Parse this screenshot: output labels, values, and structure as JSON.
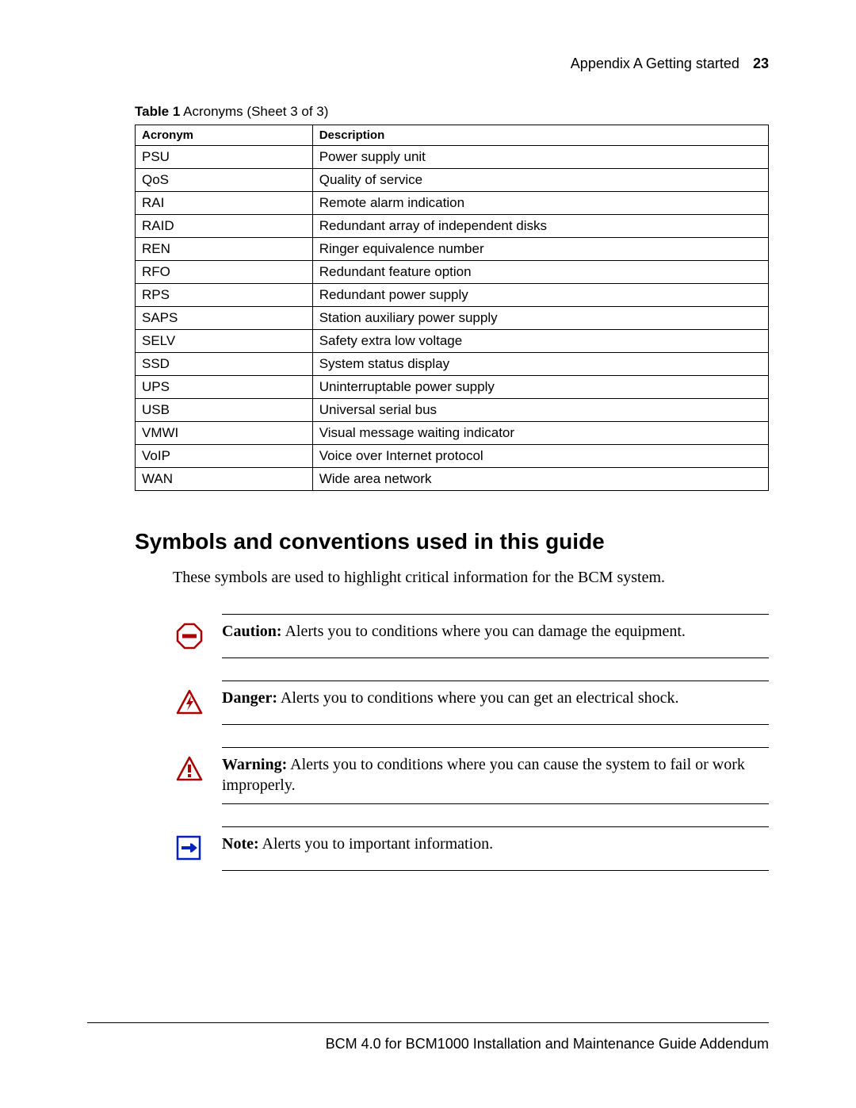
{
  "header": {
    "section": "Appendix A  Getting started",
    "page_number": "23"
  },
  "table_caption": {
    "prefix": "Table 1",
    "rest": "   Acronyms (Sheet 3 of 3)"
  },
  "table": {
    "head": {
      "col1": "Acronym",
      "col2": "Description"
    },
    "rows": [
      {
        "a": "PSU",
        "d": "Power supply unit"
      },
      {
        "a": "QoS",
        "d": "Quality of service"
      },
      {
        "a": "RAI",
        "d": "Remote alarm indication"
      },
      {
        "a": "RAID",
        "d": "Redundant array of independent disks"
      },
      {
        "a": "REN",
        "d": "Ringer equivalence number"
      },
      {
        "a": "RFO",
        "d": "Redundant feature option"
      },
      {
        "a": "RPS",
        "d": "Redundant power supply"
      },
      {
        "a": "SAPS",
        "d": "Station auxiliary power supply"
      },
      {
        "a": "SELV",
        "d": "Safety extra low voltage"
      },
      {
        "a": "SSD",
        "d": "System status display"
      },
      {
        "a": "UPS",
        "d": "Uninterruptable power supply"
      },
      {
        "a": "USB",
        "d": "Universal serial bus"
      },
      {
        "a": "VMWI",
        "d": "Visual message waiting indicator"
      },
      {
        "a": "VoIP",
        "d": "Voice over Internet protocol"
      },
      {
        "a": "WAN",
        "d": "Wide area network"
      }
    ]
  },
  "section_heading": "Symbols and conventions used in this guide",
  "intro_text": "These symbols are used to highlight critical information for the BCM system.",
  "callouts": [
    {
      "icon": "caution-icon",
      "label": "Caution:",
      "text": " Alerts you to conditions where you can damage the equipment."
    },
    {
      "icon": "danger-icon",
      "label": "Danger:",
      "text": " Alerts you to conditions where you can get an electrical shock."
    },
    {
      "icon": "warning-icon",
      "label": "Warning:",
      "text": " Alerts you to conditions where you can cause the system to fail or work improperly."
    },
    {
      "icon": "note-icon",
      "label": "Note:",
      "text": " Alerts you to important information."
    }
  ],
  "footer": "BCM 4.0 for BCM1000 Installation and Maintenance Guide Addendum"
}
